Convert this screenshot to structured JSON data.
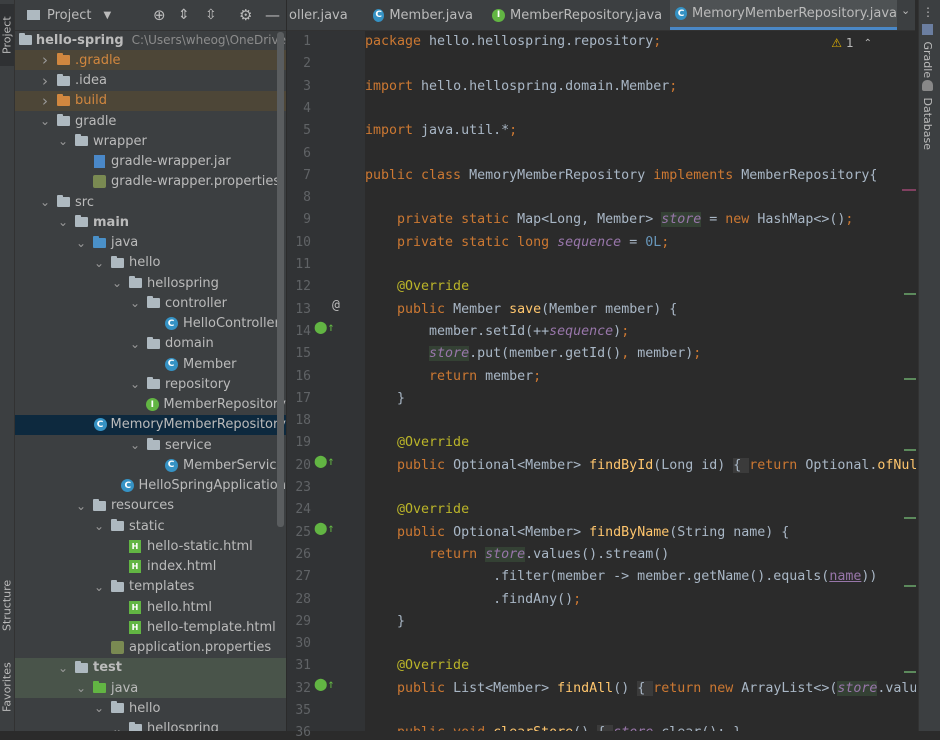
{
  "project_panel": {
    "title": "Project",
    "tree": [
      {
        "label": "hello-spring",
        "hint": "C:\\Users\\wheog\\OneDrive",
        "depth": 0,
        "arrow": "open",
        "icon": "folder",
        "bold": true
      },
      {
        "label": ".gradle",
        "depth": 1,
        "arrow": "closed",
        "icon": "folder-orange",
        "style": "excluded"
      },
      {
        "label": ".idea",
        "depth": 1,
        "arrow": "closed",
        "icon": "folder"
      },
      {
        "label": "build",
        "depth": 1,
        "arrow": "closed",
        "icon": "folder-orange",
        "style": "excluded"
      },
      {
        "label": "gradle",
        "depth": 1,
        "arrow": "open",
        "icon": "folder"
      },
      {
        "label": "wrapper",
        "depth": 2,
        "arrow": "open",
        "icon": "folder"
      },
      {
        "label": "gradle-wrapper.jar",
        "depth": 3,
        "arrow": "none",
        "icon": "jar"
      },
      {
        "label": "gradle-wrapper.properties",
        "depth": 3,
        "arrow": "none",
        "icon": "prop"
      },
      {
        "label": "src",
        "depth": 1,
        "arrow": "open",
        "icon": "folder"
      },
      {
        "label": "main",
        "depth": 2,
        "arrow": "open",
        "icon": "folder",
        "bold": true
      },
      {
        "label": "java",
        "depth": 3,
        "arrow": "open",
        "icon": "folder-blue"
      },
      {
        "label": "hello",
        "depth": 4,
        "arrow": "open",
        "icon": "folder"
      },
      {
        "label": "hellospring",
        "depth": 5,
        "arrow": "open",
        "icon": "folder"
      },
      {
        "label": "controller",
        "depth": 6,
        "arrow": "open",
        "icon": "folder"
      },
      {
        "label": "HelloController",
        "depth": 7,
        "arrow": "none",
        "icon": "class"
      },
      {
        "label": "domain",
        "depth": 6,
        "arrow": "open",
        "icon": "folder"
      },
      {
        "label": "Member",
        "depth": 7,
        "arrow": "none",
        "icon": "class"
      },
      {
        "label": "repository",
        "depth": 6,
        "arrow": "open",
        "icon": "folder"
      },
      {
        "label": "MemberRepository",
        "depth": 7,
        "arrow": "none",
        "icon": "interface"
      },
      {
        "label": "MemoryMemberRepository",
        "depth": 7,
        "arrow": "none",
        "icon": "class",
        "style": "selected"
      },
      {
        "label": "service",
        "depth": 6,
        "arrow": "open",
        "icon": "folder"
      },
      {
        "label": "MemberService",
        "depth": 7,
        "arrow": "none",
        "icon": "class"
      },
      {
        "label": "HelloSpringApplication",
        "depth": 6,
        "arrow": "none",
        "icon": "class"
      },
      {
        "label": "resources",
        "depth": 3,
        "arrow": "open",
        "icon": "folder"
      },
      {
        "label": "static",
        "depth": 4,
        "arrow": "open",
        "icon": "folder"
      },
      {
        "label": "hello-static.html",
        "depth": 5,
        "arrow": "none",
        "icon": "html"
      },
      {
        "label": "index.html",
        "depth": 5,
        "arrow": "none",
        "icon": "html"
      },
      {
        "label": "templates",
        "depth": 4,
        "arrow": "open",
        "icon": "folder"
      },
      {
        "label": "hello.html",
        "depth": 5,
        "arrow": "none",
        "icon": "html"
      },
      {
        "label": "hello-template.html",
        "depth": 5,
        "arrow": "none",
        "icon": "html"
      },
      {
        "label": "application.properties",
        "depth": 4,
        "arrow": "none",
        "icon": "prop"
      },
      {
        "label": "test",
        "depth": 2,
        "arrow": "open",
        "icon": "folder",
        "bold": true,
        "style": "test"
      },
      {
        "label": "java",
        "depth": 3,
        "arrow": "open",
        "icon": "folder-green",
        "style": "test"
      },
      {
        "label": "hello",
        "depth": 4,
        "arrow": "open",
        "icon": "folder"
      },
      {
        "label": "hellospring",
        "depth": 5,
        "arrow": "open",
        "icon": "folder"
      }
    ]
  },
  "tabs": [
    {
      "label": "oller.java",
      "icon": "class",
      "active": false
    },
    {
      "label": "Member.java",
      "icon": "class",
      "active": false
    },
    {
      "label": "MemberRepository.java",
      "icon": "interface",
      "active": false
    },
    {
      "label": "MemoryMemberRepository.java",
      "icon": "class",
      "active": true
    }
  ],
  "editor": {
    "warnings": "1",
    "line_numbers": [
      "1",
      "2",
      "3",
      "4",
      "5",
      "6",
      "7",
      "8",
      "9",
      "10",
      "11",
      "12",
      "13",
      "14",
      "15",
      "16",
      "17",
      "18",
      "19",
      "20",
      "23",
      "24",
      "25",
      "26",
      "27",
      "28",
      "29",
      "30",
      "31",
      "32",
      "35",
      "36"
    ],
    "lines": [
      [
        {
          "t": "package ",
          "c": "kw"
        },
        {
          "t": "hello.hellospring.repository"
        },
        {
          "t": ";",
          "c": "kw"
        }
      ],
      [],
      [
        {
          "t": "import ",
          "c": "kw"
        },
        {
          "t": "hello.hellospring.domain.Member"
        },
        {
          "t": ";",
          "c": "kw"
        }
      ],
      [],
      [
        {
          "t": "import ",
          "c": "kw"
        },
        {
          "t": "java.util.*"
        },
        {
          "t": ";",
          "c": "kw"
        }
      ],
      [],
      [
        {
          "t": "public class ",
          "c": "kw"
        },
        {
          "t": "MemoryMemberRepository "
        },
        {
          "t": "implements ",
          "c": "kw"
        },
        {
          "t": "MemberRepository{"
        }
      ],
      [],
      [
        {
          "t": "    private static ",
          "c": "kw"
        },
        {
          "t": "Map<Long, Member> "
        },
        {
          "t": "store",
          "c": "fld hl"
        },
        {
          "t": " = "
        },
        {
          "t": "new ",
          "c": "kw"
        },
        {
          "t": "HashMap<>()"
        },
        {
          "t": ";",
          "c": "kw"
        }
      ],
      [
        {
          "t": "    private static long ",
          "c": "kw"
        },
        {
          "t": "sequence",
          "c": "fld"
        },
        {
          "t": " = "
        },
        {
          "t": "0L",
          "c": "num"
        },
        {
          "t": ";",
          "c": "kw"
        }
      ],
      [],
      [
        {
          "t": "    @Override",
          "c": "ann"
        }
      ],
      [
        {
          "t": "    public ",
          "c": "kw"
        },
        {
          "t": "Member "
        },
        {
          "t": "save",
          "c": "fn"
        },
        {
          "t": "(Member member) {"
        }
      ],
      [
        {
          "t": "        member.setId(++"
        },
        {
          "t": "sequence",
          "c": "fld"
        },
        {
          "t": ")"
        },
        {
          "t": ";",
          "c": "kw"
        }
      ],
      [
        {
          "t": "        "
        },
        {
          "t": "store",
          "c": "fld hl"
        },
        {
          "t": ".put(member.getId()"
        },
        {
          "t": ", ",
          "c": "kw"
        },
        {
          "t": "member)"
        },
        {
          "t": ";",
          "c": "kw"
        }
      ],
      [
        {
          "t": "        return ",
          "c": "kw"
        },
        {
          "t": "member"
        },
        {
          "t": ";",
          "c": "kw"
        }
      ],
      [
        {
          "t": "    }"
        }
      ],
      [],
      [
        {
          "t": "    @Override",
          "c": "ann"
        }
      ],
      [
        {
          "t": "    public ",
          "c": "kw"
        },
        {
          "t": "Optional<Member> "
        },
        {
          "t": "findById",
          "c": "fn"
        },
        {
          "t": "(Long id) "
        },
        {
          "t": "{ ",
          "c": "fold"
        },
        {
          "t": "return ",
          "c": "kw"
        },
        {
          "t": "Optional."
        },
        {
          "t": "ofNullable",
          "c": "fn"
        }
      ],
      [],
      [
        {
          "t": "    @Override",
          "c": "ann"
        }
      ],
      [
        {
          "t": "    public ",
          "c": "kw"
        },
        {
          "t": "Optional<Member> "
        },
        {
          "t": "findByName",
          "c": "fn"
        },
        {
          "t": "(String name) {"
        }
      ],
      [
        {
          "t": "        return ",
          "c": "kw"
        },
        {
          "t": "store",
          "c": "fld hl"
        },
        {
          "t": ".values().stream()"
        }
      ],
      [
        {
          "t": "                .filter(member -> member.getName().equals("
        },
        {
          "t": "name",
          "c": "uline"
        },
        {
          "t": "))"
        }
      ],
      [
        {
          "t": "                .findAny()"
        },
        {
          "t": ";",
          "c": "kw"
        }
      ],
      [
        {
          "t": "    }"
        }
      ],
      [],
      [
        {
          "t": "    @Override",
          "c": "ann"
        }
      ],
      [
        {
          "t": "    public ",
          "c": "kw"
        },
        {
          "t": "List<Member> "
        },
        {
          "t": "findAll",
          "c": "fn"
        },
        {
          "t": "() "
        },
        {
          "t": "{ ",
          "c": "fold"
        },
        {
          "t": "return new ",
          "c": "kw"
        },
        {
          "t": "ArrayList<>("
        },
        {
          "t": "store",
          "c": "fld hl"
        },
        {
          "t": ".values"
        }
      ],
      [],
      [
        {
          "t": "    public void ",
          "c": "kw"
        },
        {
          "t": "clearStore",
          "c": "fn"
        },
        {
          "t": "() "
        },
        {
          "t": "{ ",
          "c": "fold"
        },
        {
          "t": "store",
          "c": "fld"
        },
        {
          "t": ".clear(); }"
        }
      ]
    ]
  },
  "right_tools": [
    "Gradle",
    "Database"
  ],
  "left_tools": [
    "Project",
    "Structure",
    "Favorites"
  ]
}
